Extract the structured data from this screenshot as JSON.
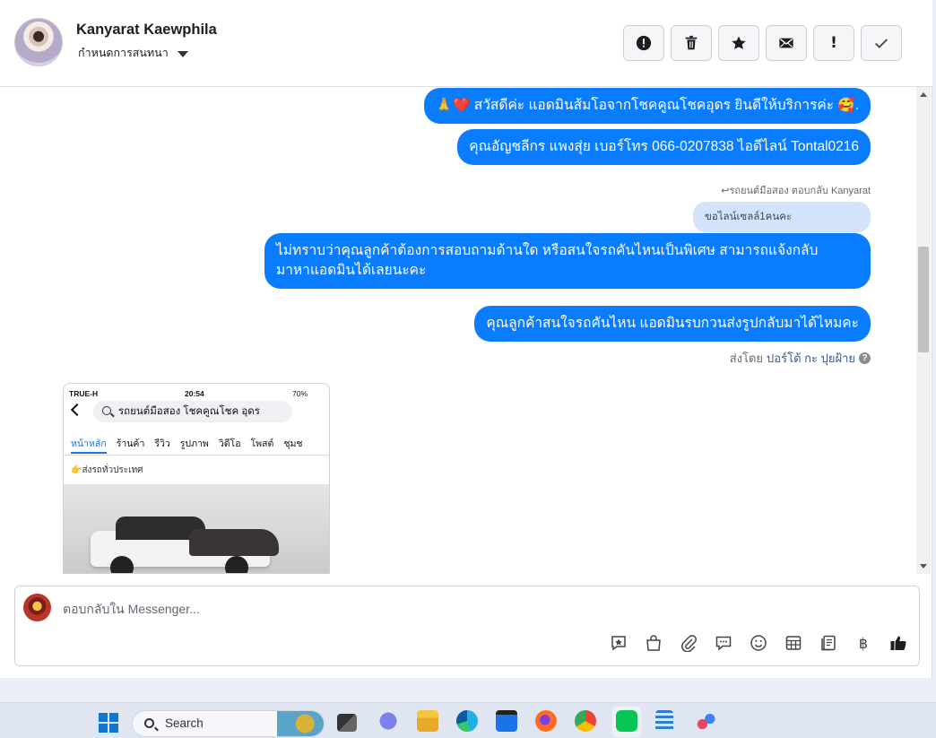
{
  "header": {
    "contact_name": "Kanyarat Kaewphila",
    "assign_label": "กำหนดการสนทนา",
    "toolbar": [
      {
        "icon": "alert-circle-icon",
        "label": "Report"
      },
      {
        "icon": "trash-icon",
        "label": "Delete"
      },
      {
        "icon": "star-icon",
        "label": "Star"
      },
      {
        "icon": "mail-icon",
        "label": "Mark unread"
      },
      {
        "icon": "exclamation-icon",
        "label": "!"
      },
      {
        "icon": "check-icon",
        "label": "Done"
      }
    ]
  },
  "messages": {
    "m1": "🙏❤️ สวัสดีค่ะ แอดมินส้มโอจากโชคคูณโชคอุดร ยินดีให้บริการค่ะ 🥰.",
    "m2": "คุณอัญชลีกร แพงสุ่ย      เบอร์โทร 066-0207838 ไอดีไลน์ Tontal0216",
    "reply_meta": "↩รถยนต์มือสอง ตอบกลับ Kanyarat",
    "quoted": "ขอไลน์เซลล์1คนคะ",
    "m3_line1": "ไม่ทราบว่าคุณลูกค้าต้องการสอบถามด้านใด หรือสนใจรถคันไหนเป็นพิเศษ สามารถแจ้งกลับ",
    "m3_line2": "มาหาแอดมินได้เลยนะคะ",
    "m4": "คุณลูกค้าสนใจรถคันไหน แอดมินรบกวนส่งรูปกลับมาได้ไหมคะ",
    "sent_by_prefix": "ส่งโดย",
    "sent_by_name": "ปอร์โต้ กะ ปุยฝ้าย",
    "info": "?"
  },
  "attachment": {
    "carrier": "TRUE-H",
    "time": "20:54",
    "battery": "70%",
    "search_text": "รถยนต์มือสอง โชคคูณโชค อุดร",
    "tabs": [
      "หน้าหลัก",
      "ร้านค้า",
      "รีวิว",
      "รูปภาพ",
      "วิดีโอ",
      "โพสต์",
      "ชุมช"
    ],
    "active_tab": "หน้าหลัก",
    "line_text": "👉ส่งรถทั่วประเทศ"
  },
  "composer": {
    "placeholder": "ตอบกลับใน Messenger...",
    "tools": [
      "chat-star-icon",
      "bag-icon",
      "paperclip-icon",
      "speech-bubble-icon",
      "emoji-icon",
      "table-icon",
      "note-icon",
      "baht-icon",
      "thumbs-up-icon"
    ],
    "baht_symbol": "฿"
  },
  "taskbar": {
    "search_label": "Search",
    "apps": [
      "windows-start-icon",
      "task-view-icon",
      "teams-icon",
      "file-explorer-icon",
      "edge-icon",
      "store-icon",
      "firefox-icon",
      "chrome-icon",
      "line-icon",
      "notepad-icon",
      "snipping-tool-icon"
    ]
  },
  "colors": {
    "bubble": "#0a7cff",
    "quoted_bubble": "#d3e3fb",
    "link": "#385898"
  }
}
